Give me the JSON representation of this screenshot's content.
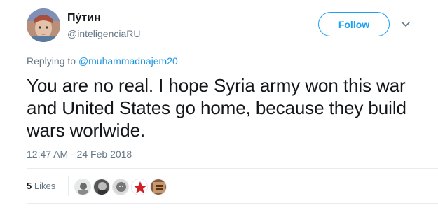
{
  "user": {
    "display_name": "Пу́тин",
    "handle": "@inteligenciaRU"
  },
  "follow_button": {
    "label": "Follow"
  },
  "reply": {
    "prefix": "Replying to ",
    "mention": "@muhammadnajem20"
  },
  "tweet": {
    "text": "You are no real. I hope Syria army won this war and United States go home, because they build wars worlwide.",
    "timestamp": "12:47 AM - 24 Feb 2018"
  },
  "stats": {
    "likes_count": "5",
    "likes_label": " Likes"
  },
  "colors": {
    "accent": "#1da1f2",
    "muted": "#657786",
    "text": "#14171a"
  },
  "icons": {
    "more": "chevron-down-icon"
  }
}
